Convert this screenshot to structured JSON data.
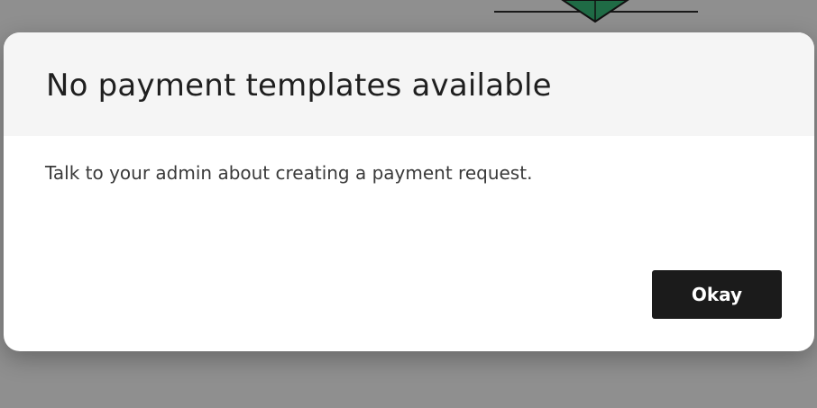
{
  "dialog": {
    "title": "No payment templates available",
    "message": "Talk to your admin about creating a payment request.",
    "okay_label": "Okay"
  },
  "colors": {
    "backdrop": "#8f8f8f",
    "modal_header_bg": "#f5f5f5",
    "modal_bg": "#ffffff",
    "button_bg": "#1b1b1b",
    "button_text": "#ffffff",
    "illustration_green": "#1f6b45"
  },
  "icons": {
    "background_illustration": "green-box-illustration"
  }
}
